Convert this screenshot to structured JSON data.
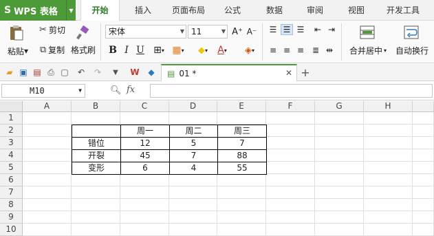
{
  "app": {
    "logo": "S",
    "name": "WPS 表格"
  },
  "tabs": [
    "开始",
    "插入",
    "页面布局",
    "公式",
    "数据",
    "审阅",
    "视图",
    "开发工具"
  ],
  "ribbon": {
    "paste": "粘贴",
    "cut": "剪切",
    "copy": "复制",
    "format_painter": "格式刷",
    "font_name": "宋体",
    "font_size": "11",
    "bold": "B",
    "italic": "I",
    "underline": "U",
    "grow_font": "A⁺",
    "shrink_font": "A⁻",
    "merge_center": "合并居中",
    "wrap_text": "自动换行"
  },
  "quickbar": {
    "doc_tab": "01 *"
  },
  "formula_bar": {
    "cell_ref": "M10",
    "fx": "fx",
    "value": ""
  },
  "columns": [
    "A",
    "B",
    "C",
    "D",
    "E",
    "F",
    "G",
    "H"
  ],
  "rows": [
    "1",
    "2",
    "3",
    "4",
    "5",
    "6",
    "7",
    "8",
    "9",
    "10"
  ],
  "table": {
    "header": [
      "",
      "周一",
      "周二",
      "周三"
    ],
    "rows": [
      [
        "错位",
        "12",
        "5",
        "7"
      ],
      [
        "开裂",
        "45",
        "7",
        "88"
      ],
      [
        "变形",
        "6",
        "4",
        "55"
      ]
    ]
  },
  "colors": {
    "wps_green": "#4d9a38",
    "active_tab_text": "#2a7a2a"
  }
}
